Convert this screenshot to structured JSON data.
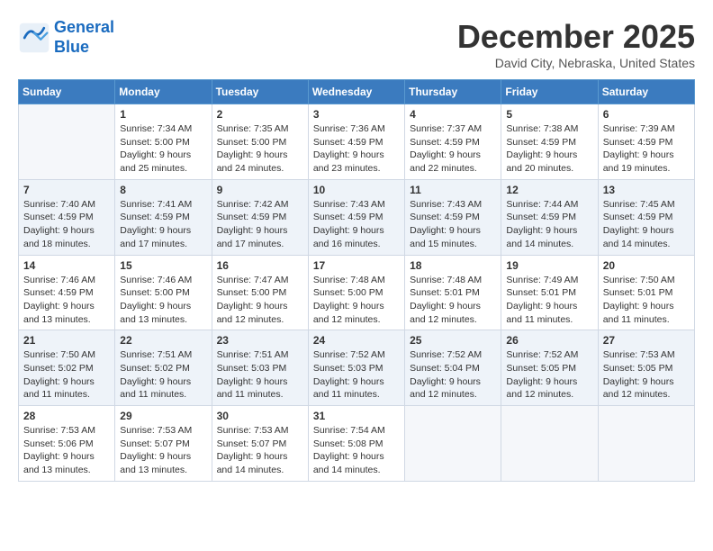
{
  "header": {
    "logo_line1": "General",
    "logo_line2": "Blue",
    "month": "December 2025",
    "location": "David City, Nebraska, United States"
  },
  "weekdays": [
    "Sunday",
    "Monday",
    "Tuesday",
    "Wednesday",
    "Thursday",
    "Friday",
    "Saturday"
  ],
  "weeks": [
    [
      {
        "day": "",
        "sunrise": "",
        "sunset": "",
        "daylight": ""
      },
      {
        "day": "1",
        "sunrise": "Sunrise: 7:34 AM",
        "sunset": "Sunset: 5:00 PM",
        "daylight": "Daylight: 9 hours and 25 minutes."
      },
      {
        "day": "2",
        "sunrise": "Sunrise: 7:35 AM",
        "sunset": "Sunset: 5:00 PM",
        "daylight": "Daylight: 9 hours and 24 minutes."
      },
      {
        "day": "3",
        "sunrise": "Sunrise: 7:36 AM",
        "sunset": "Sunset: 4:59 PM",
        "daylight": "Daylight: 9 hours and 23 minutes."
      },
      {
        "day": "4",
        "sunrise": "Sunrise: 7:37 AM",
        "sunset": "Sunset: 4:59 PM",
        "daylight": "Daylight: 9 hours and 22 minutes."
      },
      {
        "day": "5",
        "sunrise": "Sunrise: 7:38 AM",
        "sunset": "Sunset: 4:59 PM",
        "daylight": "Daylight: 9 hours and 20 minutes."
      },
      {
        "day": "6",
        "sunrise": "Sunrise: 7:39 AM",
        "sunset": "Sunset: 4:59 PM",
        "daylight": "Daylight: 9 hours and 19 minutes."
      }
    ],
    [
      {
        "day": "7",
        "sunrise": "Sunrise: 7:40 AM",
        "sunset": "Sunset: 4:59 PM",
        "daylight": "Daylight: 9 hours and 18 minutes."
      },
      {
        "day": "8",
        "sunrise": "Sunrise: 7:41 AM",
        "sunset": "Sunset: 4:59 PM",
        "daylight": "Daylight: 9 hours and 17 minutes."
      },
      {
        "day": "9",
        "sunrise": "Sunrise: 7:42 AM",
        "sunset": "Sunset: 4:59 PM",
        "daylight": "Daylight: 9 hours and 17 minutes."
      },
      {
        "day": "10",
        "sunrise": "Sunrise: 7:43 AM",
        "sunset": "Sunset: 4:59 PM",
        "daylight": "Daylight: 9 hours and 16 minutes."
      },
      {
        "day": "11",
        "sunrise": "Sunrise: 7:43 AM",
        "sunset": "Sunset: 4:59 PM",
        "daylight": "Daylight: 9 hours and 15 minutes."
      },
      {
        "day": "12",
        "sunrise": "Sunrise: 7:44 AM",
        "sunset": "Sunset: 4:59 PM",
        "daylight": "Daylight: 9 hours and 14 minutes."
      },
      {
        "day": "13",
        "sunrise": "Sunrise: 7:45 AM",
        "sunset": "Sunset: 4:59 PM",
        "daylight": "Daylight: 9 hours and 14 minutes."
      }
    ],
    [
      {
        "day": "14",
        "sunrise": "Sunrise: 7:46 AM",
        "sunset": "Sunset: 4:59 PM",
        "daylight": "Daylight: 9 hours and 13 minutes."
      },
      {
        "day": "15",
        "sunrise": "Sunrise: 7:46 AM",
        "sunset": "Sunset: 5:00 PM",
        "daylight": "Daylight: 9 hours and 13 minutes."
      },
      {
        "day": "16",
        "sunrise": "Sunrise: 7:47 AM",
        "sunset": "Sunset: 5:00 PM",
        "daylight": "Daylight: 9 hours and 12 minutes."
      },
      {
        "day": "17",
        "sunrise": "Sunrise: 7:48 AM",
        "sunset": "Sunset: 5:00 PM",
        "daylight": "Daylight: 9 hours and 12 minutes."
      },
      {
        "day": "18",
        "sunrise": "Sunrise: 7:48 AM",
        "sunset": "Sunset: 5:01 PM",
        "daylight": "Daylight: 9 hours and 12 minutes."
      },
      {
        "day": "19",
        "sunrise": "Sunrise: 7:49 AM",
        "sunset": "Sunset: 5:01 PM",
        "daylight": "Daylight: 9 hours and 11 minutes."
      },
      {
        "day": "20",
        "sunrise": "Sunrise: 7:50 AM",
        "sunset": "Sunset: 5:01 PM",
        "daylight": "Daylight: 9 hours and 11 minutes."
      }
    ],
    [
      {
        "day": "21",
        "sunrise": "Sunrise: 7:50 AM",
        "sunset": "Sunset: 5:02 PM",
        "daylight": "Daylight: 9 hours and 11 minutes."
      },
      {
        "day": "22",
        "sunrise": "Sunrise: 7:51 AM",
        "sunset": "Sunset: 5:02 PM",
        "daylight": "Daylight: 9 hours and 11 minutes."
      },
      {
        "day": "23",
        "sunrise": "Sunrise: 7:51 AM",
        "sunset": "Sunset: 5:03 PM",
        "daylight": "Daylight: 9 hours and 11 minutes."
      },
      {
        "day": "24",
        "sunrise": "Sunrise: 7:52 AM",
        "sunset": "Sunset: 5:03 PM",
        "daylight": "Daylight: 9 hours and 11 minutes."
      },
      {
        "day": "25",
        "sunrise": "Sunrise: 7:52 AM",
        "sunset": "Sunset: 5:04 PM",
        "daylight": "Daylight: 9 hours and 12 minutes."
      },
      {
        "day": "26",
        "sunrise": "Sunrise: 7:52 AM",
        "sunset": "Sunset: 5:05 PM",
        "daylight": "Daylight: 9 hours and 12 minutes."
      },
      {
        "day": "27",
        "sunrise": "Sunrise: 7:53 AM",
        "sunset": "Sunset: 5:05 PM",
        "daylight": "Daylight: 9 hours and 12 minutes."
      }
    ],
    [
      {
        "day": "28",
        "sunrise": "Sunrise: 7:53 AM",
        "sunset": "Sunset: 5:06 PM",
        "daylight": "Daylight: 9 hours and 13 minutes."
      },
      {
        "day": "29",
        "sunrise": "Sunrise: 7:53 AM",
        "sunset": "Sunset: 5:07 PM",
        "daylight": "Daylight: 9 hours and 13 minutes."
      },
      {
        "day": "30",
        "sunrise": "Sunrise: 7:53 AM",
        "sunset": "Sunset: 5:07 PM",
        "daylight": "Daylight: 9 hours and 14 minutes."
      },
      {
        "day": "31",
        "sunrise": "Sunrise: 7:54 AM",
        "sunset": "Sunset: 5:08 PM",
        "daylight": "Daylight: 9 hours and 14 minutes."
      },
      {
        "day": "",
        "sunrise": "",
        "sunset": "",
        "daylight": ""
      },
      {
        "day": "",
        "sunrise": "",
        "sunset": "",
        "daylight": ""
      },
      {
        "day": "",
        "sunrise": "",
        "sunset": "",
        "daylight": ""
      }
    ]
  ]
}
